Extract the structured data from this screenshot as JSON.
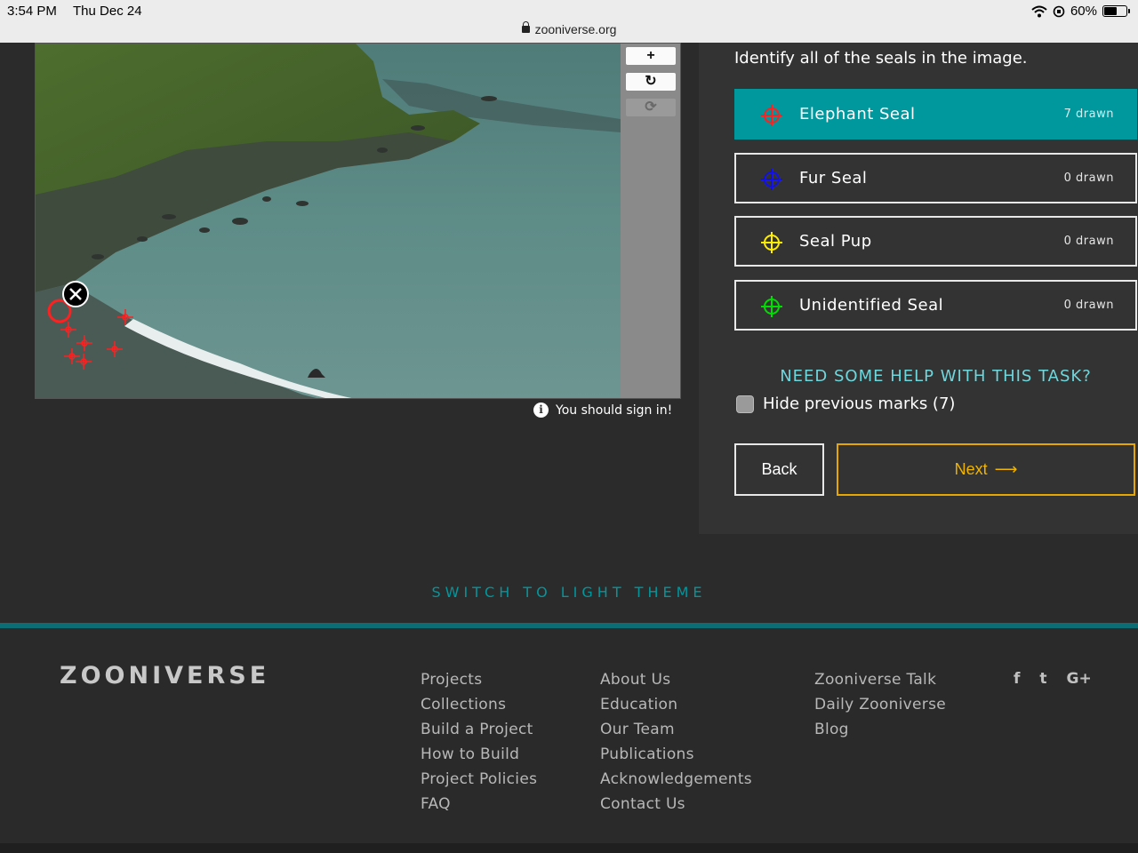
{
  "status_bar": {
    "time": "3:54 PM",
    "date": "Thu Dec 24",
    "url": "zooniverse.org",
    "battery_text": "60%",
    "battery_level": 0.6
  },
  "viewer": {
    "tools": [
      {
        "name": "zoom-in",
        "glyph": "+"
      },
      {
        "name": "rotate",
        "glyph": "↻"
      },
      {
        "name": "reset",
        "glyph": "⟳"
      }
    ],
    "sign_in_notice": "You should sign in!"
  },
  "task": {
    "instruction": "Identify all of the seals in the image.",
    "tools": [
      {
        "label": "Elephant Seal",
        "count": "7 drawn",
        "color": "#ff2020",
        "active": true
      },
      {
        "label": "Fur Seal",
        "count": "0 drawn",
        "color": "#1010ee",
        "active": false
      },
      {
        "label": "Seal Pup",
        "count": "0 drawn",
        "color": "#ffee00",
        "active": false
      },
      {
        "label": "Unidentified Seal",
        "count": "0 drawn",
        "color": "#00dd00",
        "active": false
      }
    ],
    "help": "NEED SOME HELP WITH THIS TASK?",
    "hide_marks": "Hide previous marks (7)",
    "back": "Back",
    "next": "Next",
    "next_arrow": "⟶"
  },
  "theme_switch": "SWITCH TO LIGHT THEME",
  "footer": {
    "logo": "ZOONIVERSE",
    "col1": [
      "Projects",
      "Collections",
      "Build a Project",
      "How to Build",
      "Project Policies",
      "FAQ"
    ],
    "col2": [
      "About Us",
      "Education",
      "Our Team",
      "Publications",
      "Acknowledgements",
      "Contact Us"
    ],
    "col3": [
      "Zooniverse Talk",
      "Daily Zooniverse",
      "Blog"
    ],
    "social": [
      "f",
      "t",
      "G+"
    ]
  }
}
